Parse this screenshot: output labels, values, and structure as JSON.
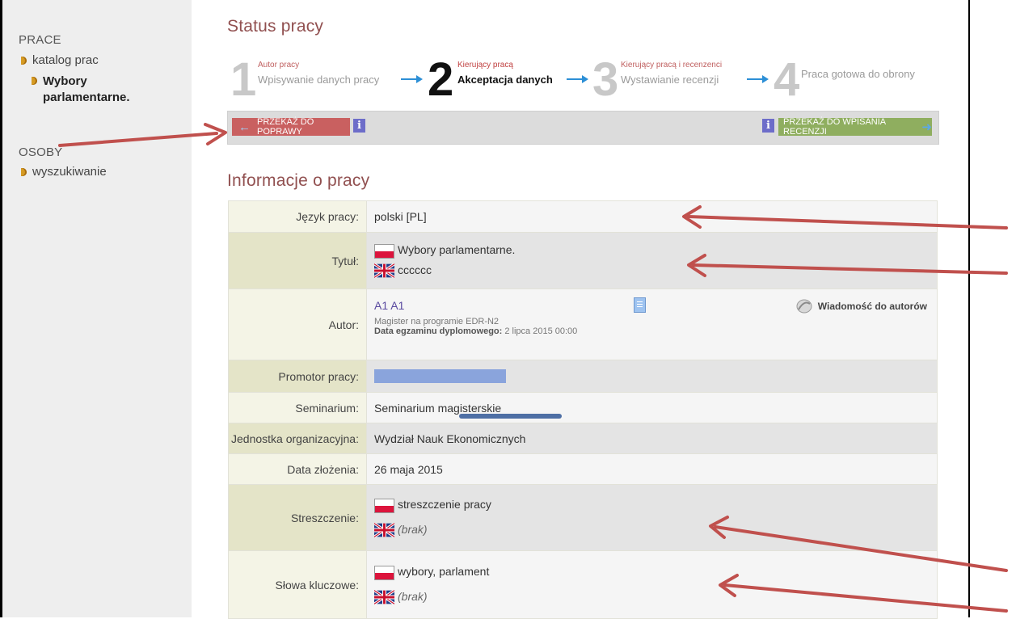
{
  "sidebar": {
    "section_prace": "PRACE",
    "catalog": "katalog prac",
    "current_work_line1": "Wybory",
    "current_work_line2": "parlamentarne.",
    "section_osoby": "OSOBY",
    "search": "wyszukiwanie"
  },
  "status": {
    "title": "Status pracy",
    "steps": [
      {
        "num": "1",
        "small": "Autor pracy",
        "desc": "Wpisywanie danych pracy"
      },
      {
        "num": "2",
        "small": "Kierujący pracą",
        "desc": "Akceptacja danych"
      },
      {
        "num": "3",
        "small": "Kierujący pracą i recenzenci",
        "desc": "Wystawianie recenzji"
      },
      {
        "num": "4",
        "small": "",
        "desc": "Praca gotowa do obrony"
      }
    ],
    "active_step": 2,
    "btn_back": "PRZEKAŻ DO POPRAWY",
    "btn_forward": "PRZEKAŻ DO WPISANIA RECENZJI",
    "info_icon": "i"
  },
  "info": {
    "title": "Informacje o pracy",
    "rows": {
      "language": {
        "label": "Język pracy:",
        "value": "polski [PL]"
      },
      "title": {
        "label": "Tytuł:",
        "pl": "Wybory parlamentarne.",
        "en": "cccccc"
      },
      "author": {
        "label": "Autor:",
        "name": "A1 A1",
        "program": "Magister na programie EDR-N2",
        "exam_label": "Data egzaminu dyplomowego:",
        "exam_date": "2 lipca 2015 00:00",
        "message": "Wiadomość do autorów"
      },
      "promoter": {
        "label": "Promotor pracy:"
      },
      "seminar": {
        "label": "Seminarium:",
        "value": "Seminarium magisterskie"
      },
      "unit": {
        "label": "Jednostka organizacyjna:",
        "value": "Wydział Nauk Ekonomicznych"
      },
      "date": {
        "label": "Data złożenia:",
        "value": "26 maja 2015"
      },
      "abstract": {
        "label": "Streszczenie:",
        "pl": "streszczenie pracy",
        "en": "(brak)"
      },
      "keywords": {
        "label": "Słowa kluczowe:",
        "pl": "wybory, parlament",
        "en": "(brak)"
      }
    }
  },
  "colors": {
    "annotation_arrow": "#c0504d",
    "step_arrow": "#2c8fd6",
    "accent_title": "#915050"
  }
}
